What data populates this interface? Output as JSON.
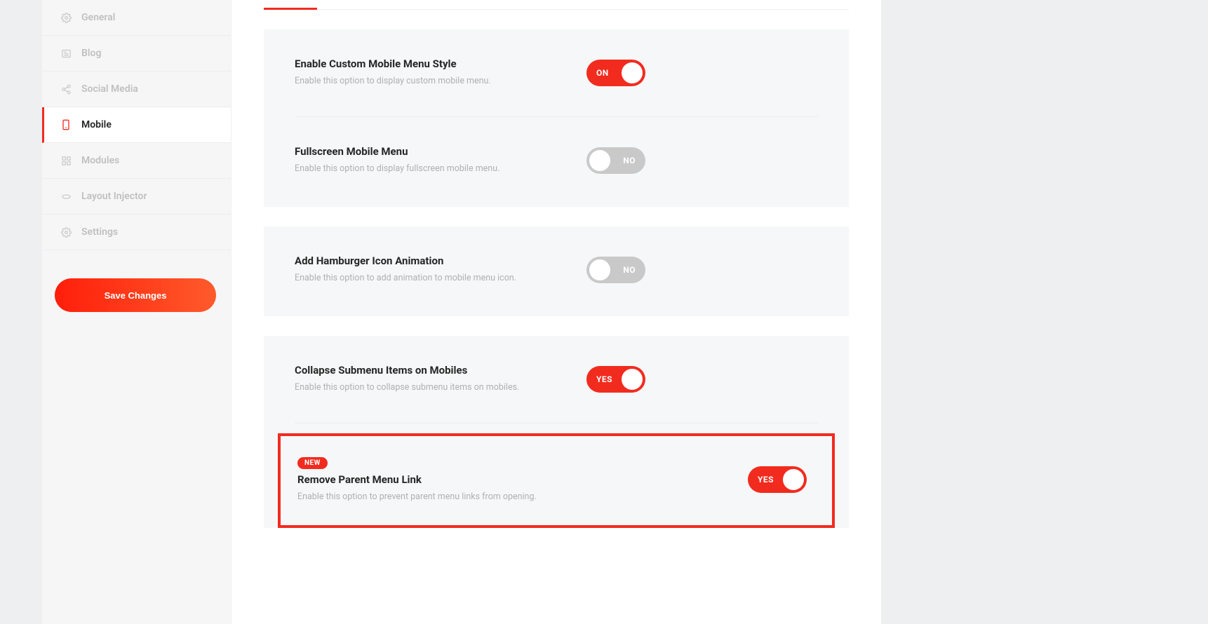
{
  "sidebar": {
    "items": [
      {
        "label": "General"
      },
      {
        "label": "Blog"
      },
      {
        "label": "Social Media"
      },
      {
        "label": "Mobile"
      },
      {
        "label": "Modules"
      },
      {
        "label": "Layout Injector"
      },
      {
        "label": "Settings"
      }
    ],
    "save_label": "Save Changes"
  },
  "settings": {
    "s1": {
      "title": "Enable Custom Mobile Menu Style",
      "desc": "Enable this option to display custom mobile menu.",
      "toggle_label": "ON"
    },
    "s2": {
      "title": "Fullscreen Mobile Menu",
      "desc": "Enable this option to display fullscreen mobile menu.",
      "toggle_label": "NO"
    },
    "s3": {
      "title": "Add Hamburger Icon Animation",
      "desc": "Enable this option to add animation to mobile menu icon.",
      "toggle_label": "NO"
    },
    "s4": {
      "title": "Collapse Submenu Items on Mobiles",
      "desc": "Enable this option to collapse submenu items on mobiles.",
      "toggle_label": "YES"
    },
    "s5": {
      "badge": "NEW",
      "title": "Remove Parent Menu Link",
      "desc": "Enable this option to prevent parent menu links from opening.",
      "toggle_label": "YES"
    }
  }
}
